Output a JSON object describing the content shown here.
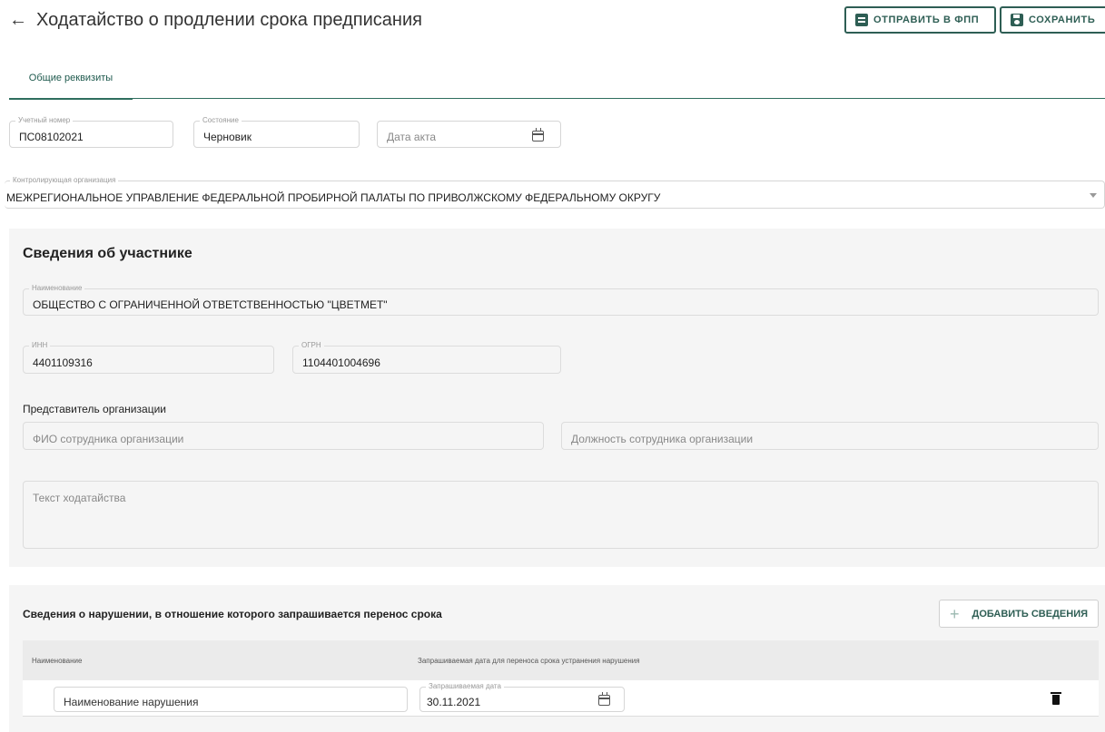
{
  "header": {
    "back_icon": "arrow-left-icon",
    "title": "Ходатайство о продлении срока предписания",
    "send_button": "ОТПРАВИТЬ В ФПП",
    "save_button": "СОХРАНИТЬ"
  },
  "tabs": [
    {
      "label": "Общие реквизиты",
      "active": true
    }
  ],
  "general": {
    "account_number": {
      "label": "Учетный номер",
      "value": "ПС08102021"
    },
    "state": {
      "label": "Состояние",
      "value": "Черновик"
    },
    "act_date": {
      "placeholder": "Дата акта"
    },
    "control_org": {
      "label": "Контролирующая организация",
      "value": "МЕЖРЕГИОНАЛЬНОЕ УПРАВЛЕНИЕ ФЕДЕРАЛЬНОЙ ПРОБИРНОЙ ПАЛАТЫ ПО ПРИВОЛЖСКОМУ ФЕДЕРАЛЬНОМУ ОКРУГУ"
    }
  },
  "participant": {
    "title": "Сведения об участнике",
    "name": {
      "label": "Наименование",
      "value": "ОБЩЕСТВО С ОГРАНИЧЕННОЙ ОТВЕТСТВЕННОСТЬЮ \"ЦВЕТМЕТ\""
    },
    "inn": {
      "label": "ИНН",
      "value": "4401109316"
    },
    "ogrn": {
      "label": "ОГРН",
      "value": "1104401004696"
    },
    "representative_label": "Представитель организации",
    "employee_name": {
      "placeholder": "ФИО сотрудника организации"
    },
    "employee_position": {
      "placeholder": "Должность сотрудника организации"
    },
    "petition_text": {
      "placeholder": "Текст ходатайства"
    }
  },
  "violations": {
    "title": "Сведения о нарушении, в отношение которого запрашивается перенос срока",
    "add_button": "ДОБАВИТЬ СВЕДЕНИЯ",
    "columns": [
      "Наименование",
      "Запрашиваемая дата для переноса срока устранения нарушения"
    ],
    "rows": [
      {
        "name_placeholder": "Наименование нарушения",
        "date_label": "Запрашиваемая дата",
        "date_value": "30.11.2021"
      }
    ]
  },
  "colors": {
    "accent": "#2e5e54",
    "section_bg": "#f5f5f5"
  }
}
